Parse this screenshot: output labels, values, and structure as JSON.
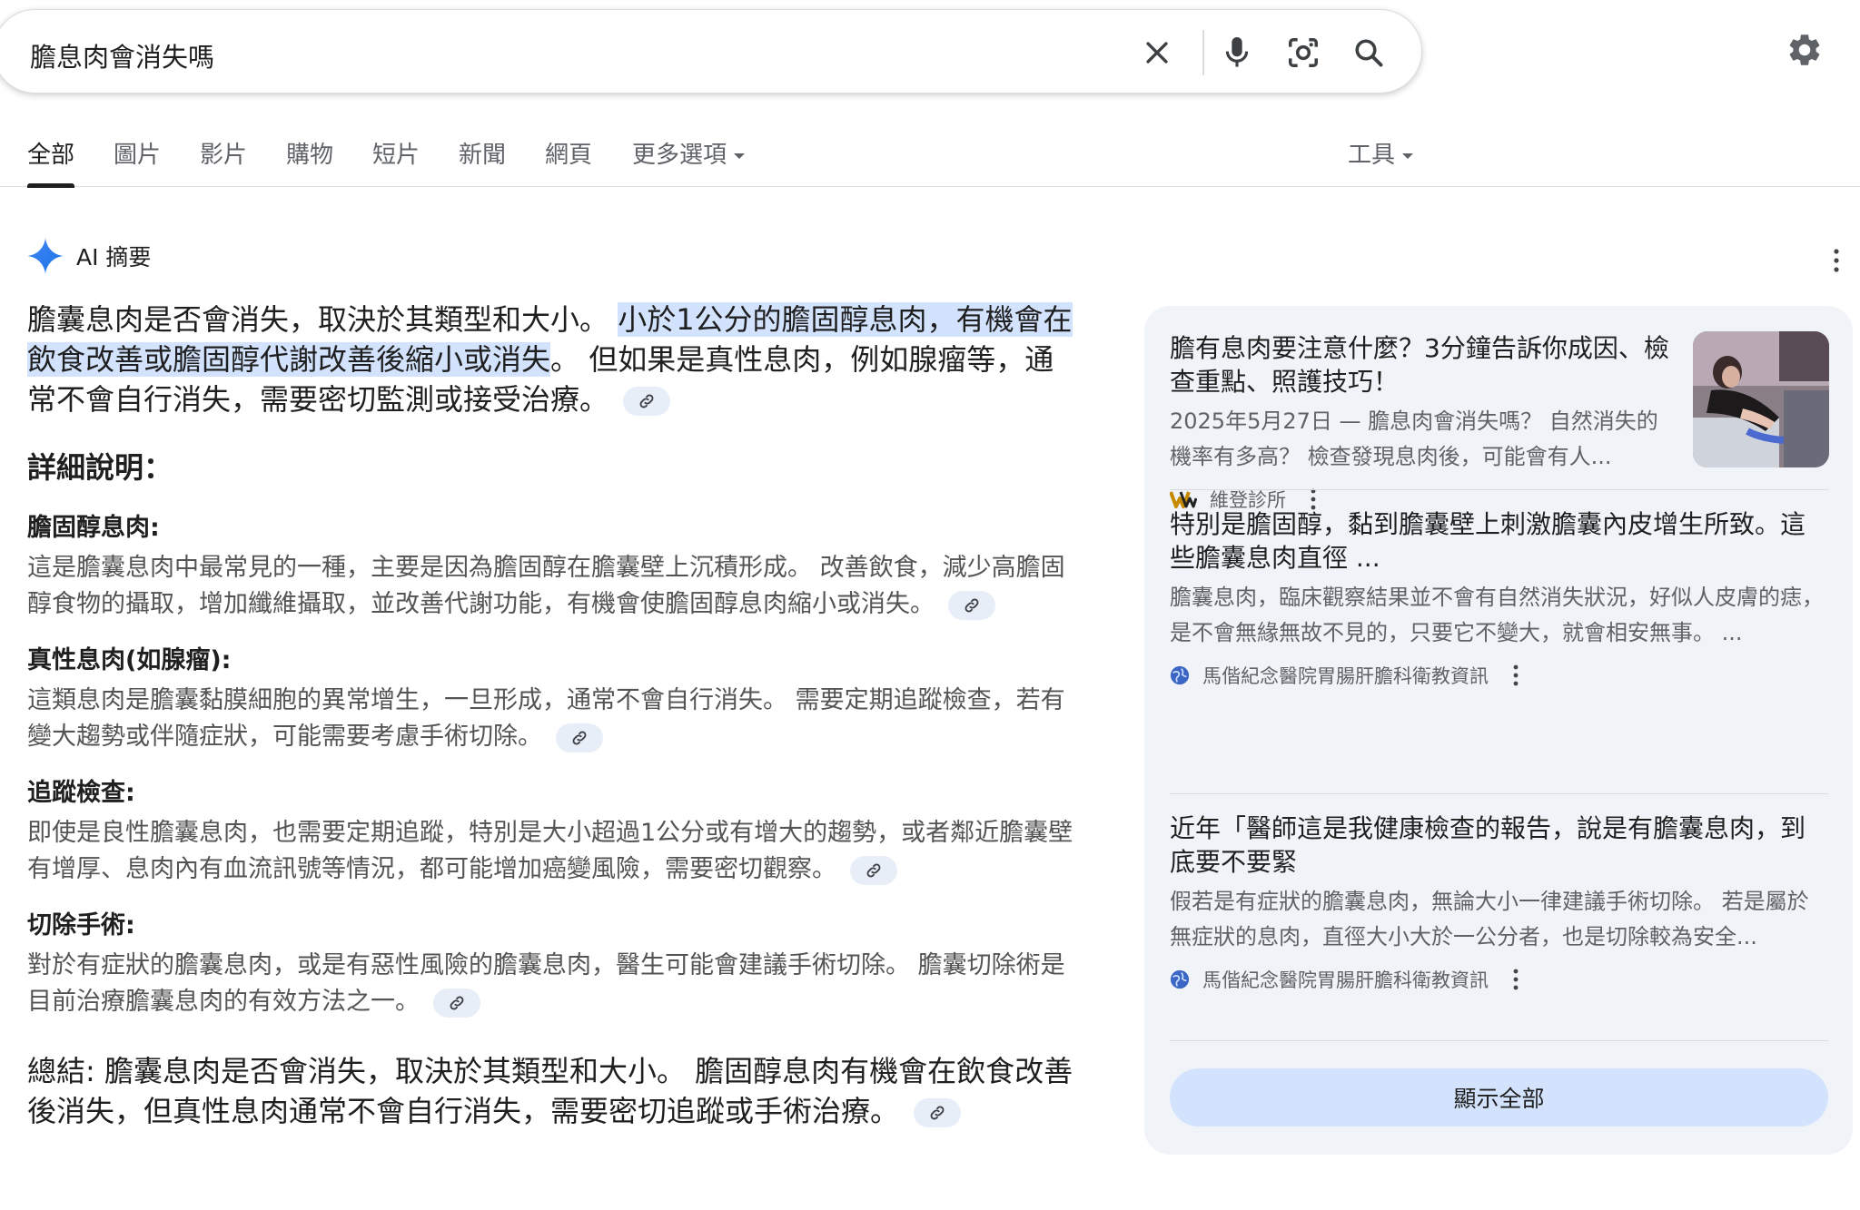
{
  "search": {
    "query": "膽息肉會消失嗎",
    "clear_icon": "close-icon",
    "voice_icon": "mic-icon",
    "lens_icon": "camera-lens-icon",
    "search_icon": "search-icon",
    "settings_icon": "gear-icon"
  },
  "tabs": {
    "items": [
      {
        "label": "全部",
        "active": true
      },
      {
        "label": "圖片"
      },
      {
        "label": "影片"
      },
      {
        "label": "購物"
      },
      {
        "label": "短片"
      },
      {
        "label": "新聞"
      },
      {
        "label": "網頁"
      },
      {
        "label": "更多選項"
      }
    ],
    "tools_label": "工具"
  },
  "ai_overview": {
    "title": "AI 摘要",
    "intro_plain_1": "膽囊息肉是否會消失，取決於其類型和大小。 ",
    "intro_highlight": "小於1公分的膽固醇息肉，有機會在飲食改善或膽固醇代謝改善後縮小或消失",
    "intro_plain_2": "。 但如果是真性息肉，例如腺瘤等，通常不會自行消失，需要密切監測或接受治療。",
    "details_heading": "詳細說明：",
    "sections": [
      {
        "title": "膽固醇息肉:",
        "body": "這是膽囊息肉中最常見的一種，主要是因為膽固醇在膽囊壁上沉積形成。 改善飲食，減少高膽固醇食物的攝取，增加纖維攝取，並改善代謝功能，有機會使膽固醇息肉縮小或消失。"
      },
      {
        "title": "真性息肉(如腺瘤):",
        "body": "這類息肉是膽囊黏膜細胞的異常增生，一旦形成，通常不會自行消失。 需要定期追蹤檢查，若有變大趨勢或伴隨症狀，可能需要考慮手術切除。"
      },
      {
        "title": "追蹤檢查:",
        "body": "即使是良性膽囊息肉，也需要定期追蹤，特別是大小超過1公分或有增大的趨勢，或者鄰近膽囊壁有增厚、息肉內有血流訊號等情況，都可能增加癌變風險，需要密切觀察。"
      },
      {
        "title": "切除手術:",
        "body": "對於有症狀的膽囊息肉，或是有惡性風險的膽囊息肉，醫生可能會建議手術切除。 膽囊切除術是目前治療膽囊息肉的有效方法之一。"
      }
    ],
    "summary": "總結: 膽囊息肉是否會消失，取決於其類型和大小。 膽固醇息肉有機會在飲食改善後消失，但真性息肉通常不會自行消失，需要密切追蹤或手術治療。"
  },
  "sources": {
    "items": [
      {
        "title": "膽有息肉要注意什麼？3分鐘告訴你成因、檢查重點、照護技巧！",
        "snippet": "2025年5月27日 — 膽息肉會消失嗎？ 自然消失的機率有多高？ 檢查發現息肉後，可能會有人...",
        "source": "維登診所"
      },
      {
        "title": "特別是膽固醇，黏到膽囊壁上刺激膽囊內皮增生所致。這些膽囊息肉直徑 ...",
        "snippet": "膽囊息肉，臨床觀察結果並不會有自然消失狀況，好似人皮膚的痣，是不會無緣無故不見的，只要它不變大，就會相安無事。 ...",
        "source": "馬偕紀念醫院胃腸肝膽科衛教資訊"
      },
      {
        "title": "近年「醫師這是我健康檢查的報告，說是有膽囊息肉，到底要不要緊",
        "snippet": "假若是有症狀的膽囊息肉，無論大小一律建議手術切除。 若是屬於無症狀的息肉，直徑大小大於一公分者，也是切除較為安全...",
        "source": "馬偕紀念醫院胃腸肝膽科衛教資訊"
      }
    ],
    "show_all_label": "顯示全部"
  },
  "colors": {
    "highlight": "#d3e3fd",
    "panel_bg": "#f0f4f9",
    "sparkle": "#4285f4"
  }
}
